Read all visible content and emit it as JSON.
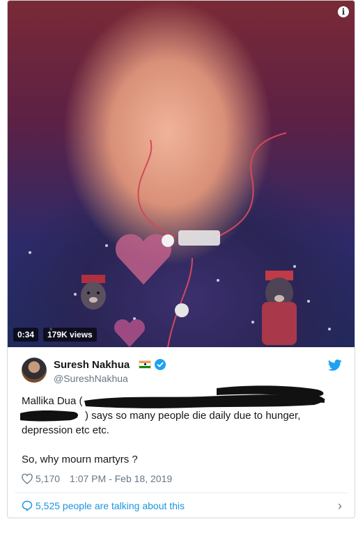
{
  "video": {
    "duration": "0:34",
    "views": "179K views",
    "info_icon": "i"
  },
  "tweet": {
    "author_name": "Suresh Nakhua",
    "handle": "@SureshNakhua",
    "flag_icon": "india-flag-icon",
    "verified_icon": "verified-badge-icon",
    "brand_icon": "twitter-bird-icon",
    "text_line1_start": "Mallika Dua (",
    "text_line2": ") says so many people die daily due to hunger,",
    "text_line3": "depression etc etc.",
    "text_line4": "So, why mourn martyrs ?",
    "likes": "5,170",
    "timestamp": "1:07 PM - Feb 18, 2019"
  },
  "footer": {
    "talking": "5,525 people are talking about this",
    "chevron": "›"
  },
  "colors": {
    "link": "#1b95e0",
    "muted": "#657786",
    "text": "#14171a"
  }
}
